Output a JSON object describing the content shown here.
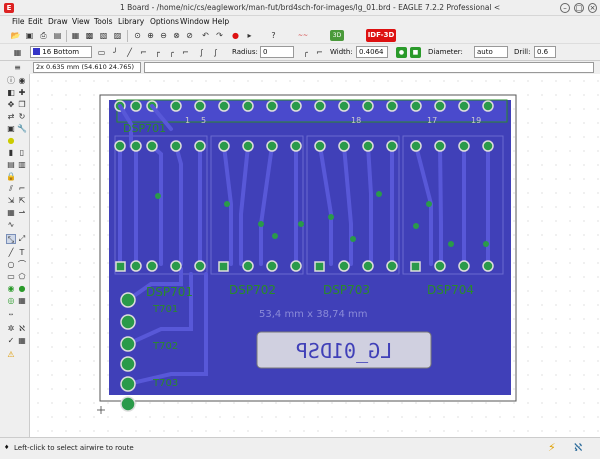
{
  "window": {
    "title": "1 Board - /home/nic/cs/eaglework/man-fut/brd4sch-for-images/lg_01.brd - EAGLE 7.2.2 Professional <2>",
    "app_icon": "E"
  },
  "menu": [
    "File",
    "Edit",
    "Draw",
    "View",
    "Tools",
    "Library",
    "Options",
    "Window",
    "Help"
  ],
  "toolbar": {
    "idf_label": "IDF-3D",
    "badge_label": "3D"
  },
  "params": {
    "layer": "16 Bottom",
    "layer_color": "#3535c8",
    "radius_label": "Radius:",
    "radius_value": "0",
    "width_label": "Width:",
    "width_value": "0.4064",
    "diameter_label": "Diameter:",
    "diameter_value": "auto",
    "drill_label": "Drill:",
    "drill_value": "0.6"
  },
  "command": {
    "coordinate": "2x 0.635 mm (54.610 24.765)",
    "placeholder": ""
  },
  "board": {
    "dimension": "53,4 mm x 38,74 mm",
    "logo": "LG_01DSP",
    "labels": [
      "DSP701",
      "DSP702",
      "DSP703",
      "DSP704",
      "T702",
      "T701",
      "T703"
    ],
    "header_pins": [
      "1",
      "5",
      "18",
      "17",
      "19"
    ],
    "colors": {
      "board_bg": "#4040b8",
      "trace": "#4a4acc",
      "outline": "#555555",
      "pad_ring": "#cccccc",
      "copper": "#2a9a4a",
      "text": "#2a8a2a"
    }
  },
  "status": {
    "message": "Left-click to select airwire to route"
  }
}
